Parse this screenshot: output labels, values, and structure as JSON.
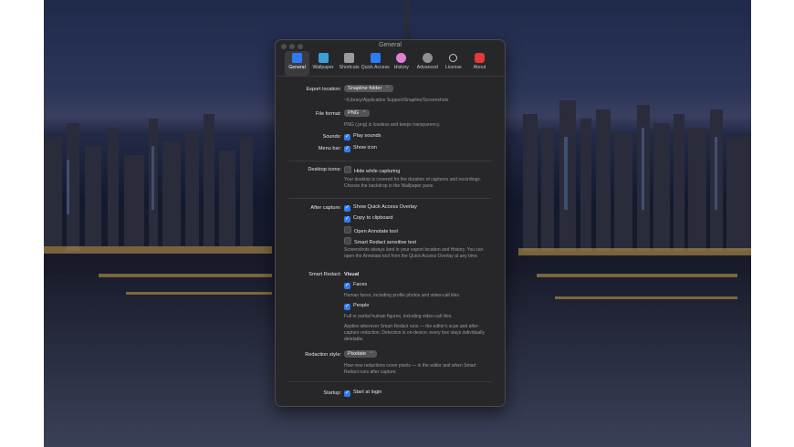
{
  "window": {
    "title": "General"
  },
  "tabs": [
    {
      "label": "General",
      "icon": "general-icon",
      "color": "#2d7cf6"
    },
    {
      "label": "Wallpaper",
      "icon": "wallpaper-icon",
      "color": "#3aa0d8"
    },
    {
      "label": "Shortcuts",
      "icon": "shortcuts-icon",
      "color": "#9a9aa0"
    },
    {
      "label": "Quick Access",
      "icon": "quick-access-icon",
      "color": "#2d7cf6"
    },
    {
      "label": "History",
      "icon": "history-icon",
      "color": "#e07fd2"
    },
    {
      "label": "Advanced",
      "icon": "advanced-icon",
      "color": "#8e8e93"
    },
    {
      "label": "License",
      "icon": "license-icon",
      "color": "#c7c7cc"
    },
    {
      "label": "About",
      "icon": "about-icon",
      "color": "#e53935"
    }
  ],
  "export": {
    "label": "Export location:",
    "value": "Snapline folder",
    "path": "~/Library/Application Support/Snapline/Screenshots"
  },
  "file_format": {
    "label": "File format:",
    "value": "PNG",
    "desc": "PNG (.png) is lossless and keeps transparency."
  },
  "sounds": {
    "label": "Sounds:",
    "option": "Play sounds"
  },
  "menubar": {
    "label": "Menu bar:",
    "option": "Show icon"
  },
  "desktop": {
    "label": "Desktop icons:",
    "option": "Hide while capturing",
    "desc": "Your desktop is covered for the duration of captures and recordings. Choose the backdrop in the Wallpaper pane."
  },
  "after": {
    "label": "After capture:",
    "opt1": "Show Quick Access Overlay",
    "opt2": "Copy to clipboard",
    "opt3": "Open Annotate tool",
    "opt4": "Smart Redact sensitive text",
    "desc": "Screenshots always land in your export location and History. You can open the Annotate tool from the Quick Access Overlay at any time."
  },
  "redact": {
    "label": "Smart Redact:",
    "heading": "Visual",
    "faces": "Faces",
    "faces_desc": "Human faces, including profile photos and video-call tiles.",
    "people": "People",
    "people_desc": "Full or partial human figures, including video-call tiles.",
    "desc": "Applies wherever Smart Redact runs — the editor's scan and after-capture redaction. Detection is on-device; every box stays individually deletable."
  },
  "redaction_style": {
    "label": "Redaction style:",
    "value": "Pixelate",
    "desc": "How new redactions cover pixels — in the editor and when Smart Redact runs after capture."
  },
  "startup": {
    "label": "Startup:",
    "option": "Start at login"
  }
}
